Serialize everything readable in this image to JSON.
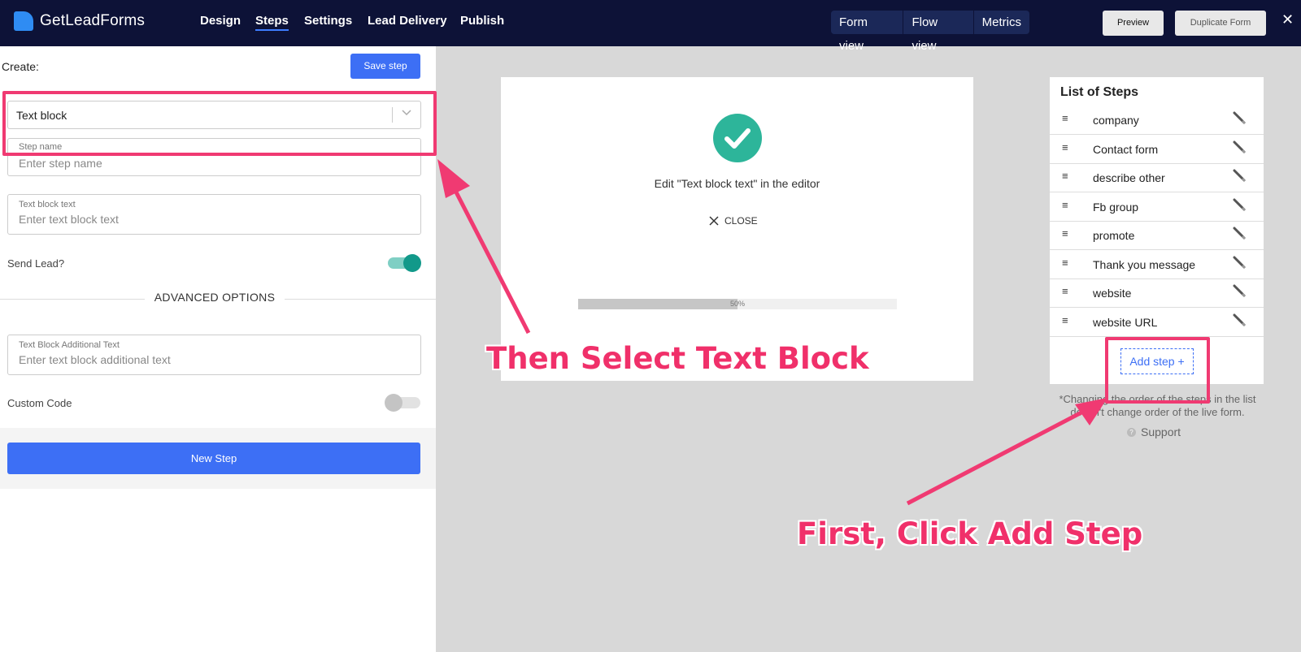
{
  "app": {
    "name": "GetLeadForms"
  },
  "nav": {
    "items": [
      "Design",
      "Steps",
      "Settings",
      "Lead Delivery",
      "Publish"
    ],
    "active": "Steps"
  },
  "views": [
    "Form view",
    "Flow view",
    "Metrics"
  ],
  "header_buttons": {
    "preview": "Preview",
    "duplicate": "Duplicate Form",
    "close": "✕"
  },
  "editor": {
    "create_label": "Create:",
    "save_button": "Save step",
    "step_type": {
      "selected": "Text block"
    },
    "step_name": {
      "label": "Step name",
      "placeholder": "Enter step name"
    },
    "text_block_text": {
      "label": "Text block text",
      "placeholder": "Enter text block text"
    },
    "send_lead": {
      "label": "Send Lead?",
      "on": true
    },
    "advanced_options": "ADVANCED OPTIONS",
    "additional_text": {
      "label": "Text Block Additional Text",
      "placeholder": "Enter text block additional text"
    },
    "custom_code": {
      "label": "Custom Code",
      "on": false
    },
    "new_step_button": "New Step"
  },
  "preview": {
    "message": "Edit \"Text block text\" in the editor",
    "close_label": "CLOSE",
    "progress": {
      "percent": 50,
      "label": "50%"
    }
  },
  "steps_list": {
    "title": "List of Steps",
    "items": [
      "company",
      "Contact form",
      "describe other",
      "Fb group",
      "promote",
      "Thank you message",
      "website",
      "website URL"
    ],
    "add_step": "Add step +",
    "note": "*Changing the order of the steps in the list doesn't change order of the live form.",
    "support": "Support"
  },
  "annotations": {
    "select_text_block": "Then Select Text Block",
    "click_add_step": "First, Click Add Step"
  },
  "colors": {
    "topbar": "#0d1237",
    "accent": "#3d6ff5",
    "annotation": "#f03a72",
    "success": "#2db59a",
    "toggle_on": "#12998a"
  }
}
